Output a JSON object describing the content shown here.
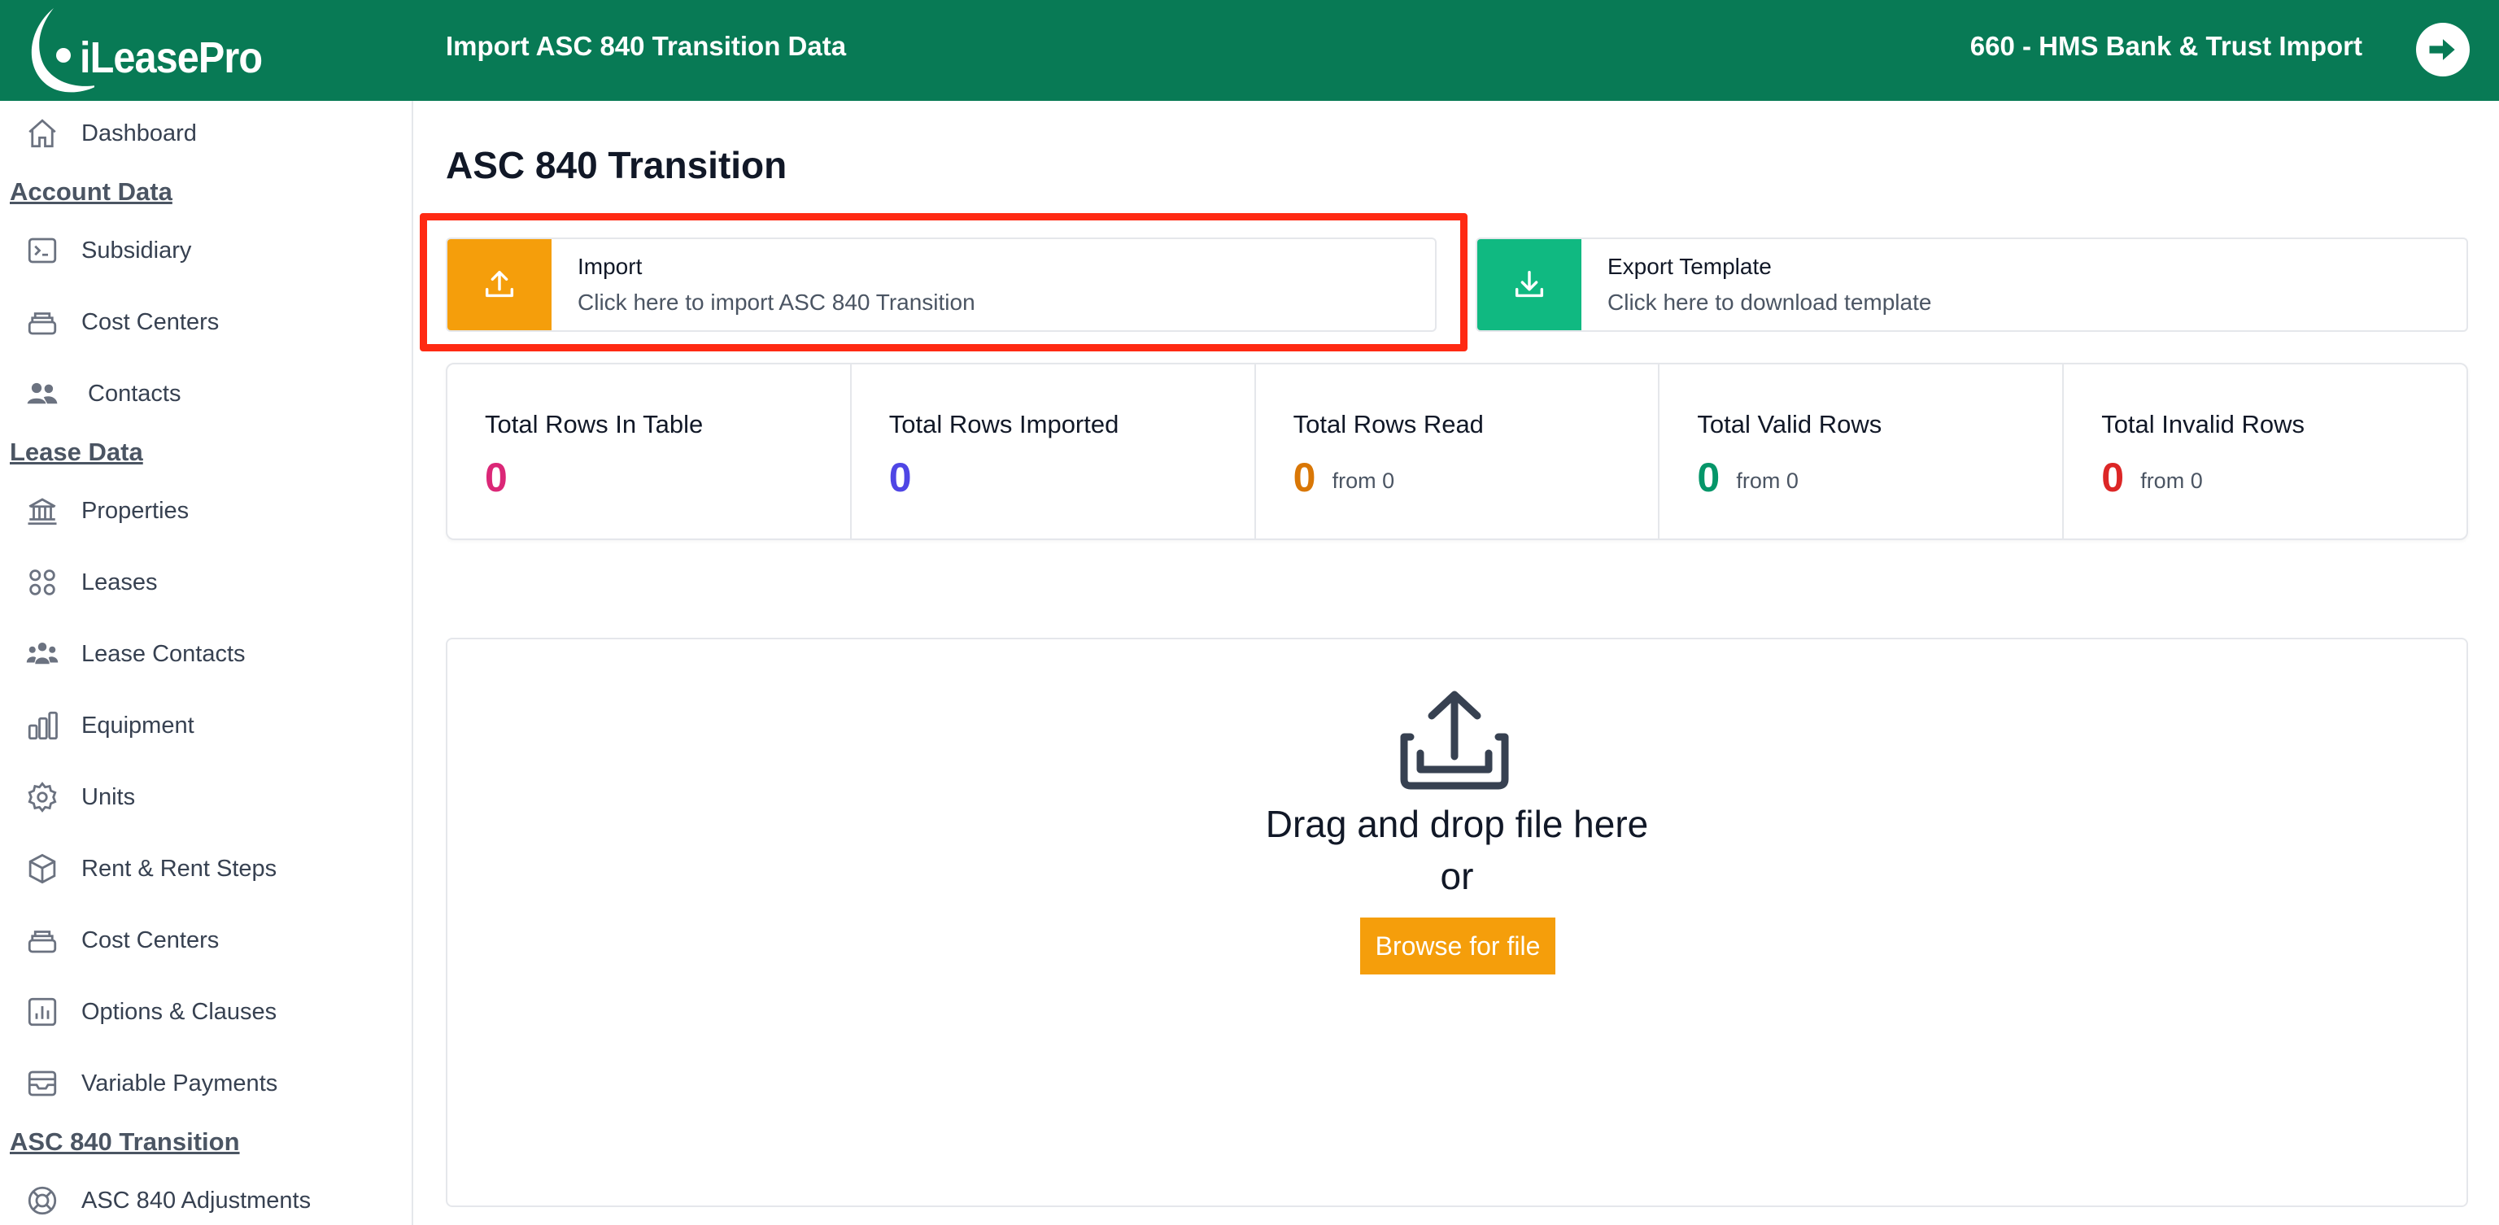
{
  "brand": {
    "name": "iLeasePro"
  },
  "header": {
    "title": "Import ASC 840 Transition Data",
    "account": "660 - HMS Bank & Trust Import"
  },
  "sidebar": {
    "items": [
      {
        "label": "Dashboard",
        "icon": "home-icon"
      },
      {
        "section": "Account Data"
      },
      {
        "label": "Subsidiary",
        "icon": "terminal-icon"
      },
      {
        "label": "Cost Centers",
        "icon": "stack-icon"
      },
      {
        "label": "Contacts",
        "icon": "users-icon"
      },
      {
        "section": "Lease Data"
      },
      {
        "label": "Properties",
        "icon": "building-icon"
      },
      {
        "label": "Leases",
        "icon": "grid-icon"
      },
      {
        "label": "Lease Contacts",
        "icon": "user-group-icon"
      },
      {
        "label": "Equipment",
        "icon": "bar-chart-icon"
      },
      {
        "label": "Units",
        "icon": "gear-icon"
      },
      {
        "label": "Rent & Rent Steps",
        "icon": "cube-icon"
      },
      {
        "label": "Cost Centers",
        "icon": "stack-icon"
      },
      {
        "label": "Options & Clauses",
        "icon": "chart-square-icon"
      },
      {
        "label": "Variable Payments",
        "icon": "archive-icon"
      },
      {
        "section": "ASC 840 Transition"
      },
      {
        "label": "ASC 840 Adjustments",
        "icon": "lifebuoy-icon"
      }
    ]
  },
  "main": {
    "title": "ASC 840 Transition",
    "import_card": {
      "title": "Import",
      "subtitle": "Click here to import ASC 840 Transition"
    },
    "export_card": {
      "title": "Export Template",
      "subtitle": "Click here to download template"
    },
    "stats": [
      {
        "label": "Total Rows In Table",
        "value": "0",
        "color": "#db2777"
      },
      {
        "label": "Total Rows Imported",
        "value": "0",
        "color": "#4f46e5"
      },
      {
        "label": "Total Rows Read",
        "value": "0",
        "from": "from 0",
        "color": "#d97706"
      },
      {
        "label": "Total Valid Rows",
        "value": "0",
        "from": "from 0",
        "color": "#059669"
      },
      {
        "label": "Total Invalid Rows",
        "value": "0",
        "from": "from 0",
        "color": "#dc2626"
      }
    ],
    "dropzone": {
      "line1": "Drag and drop file here",
      "line2": "or",
      "browse_label": "Browse for file"
    }
  },
  "colors": {
    "topbar": "#087a55",
    "import_accent": "#f59e0b",
    "export_accent": "#10b981",
    "highlight": "#ff2a13"
  }
}
